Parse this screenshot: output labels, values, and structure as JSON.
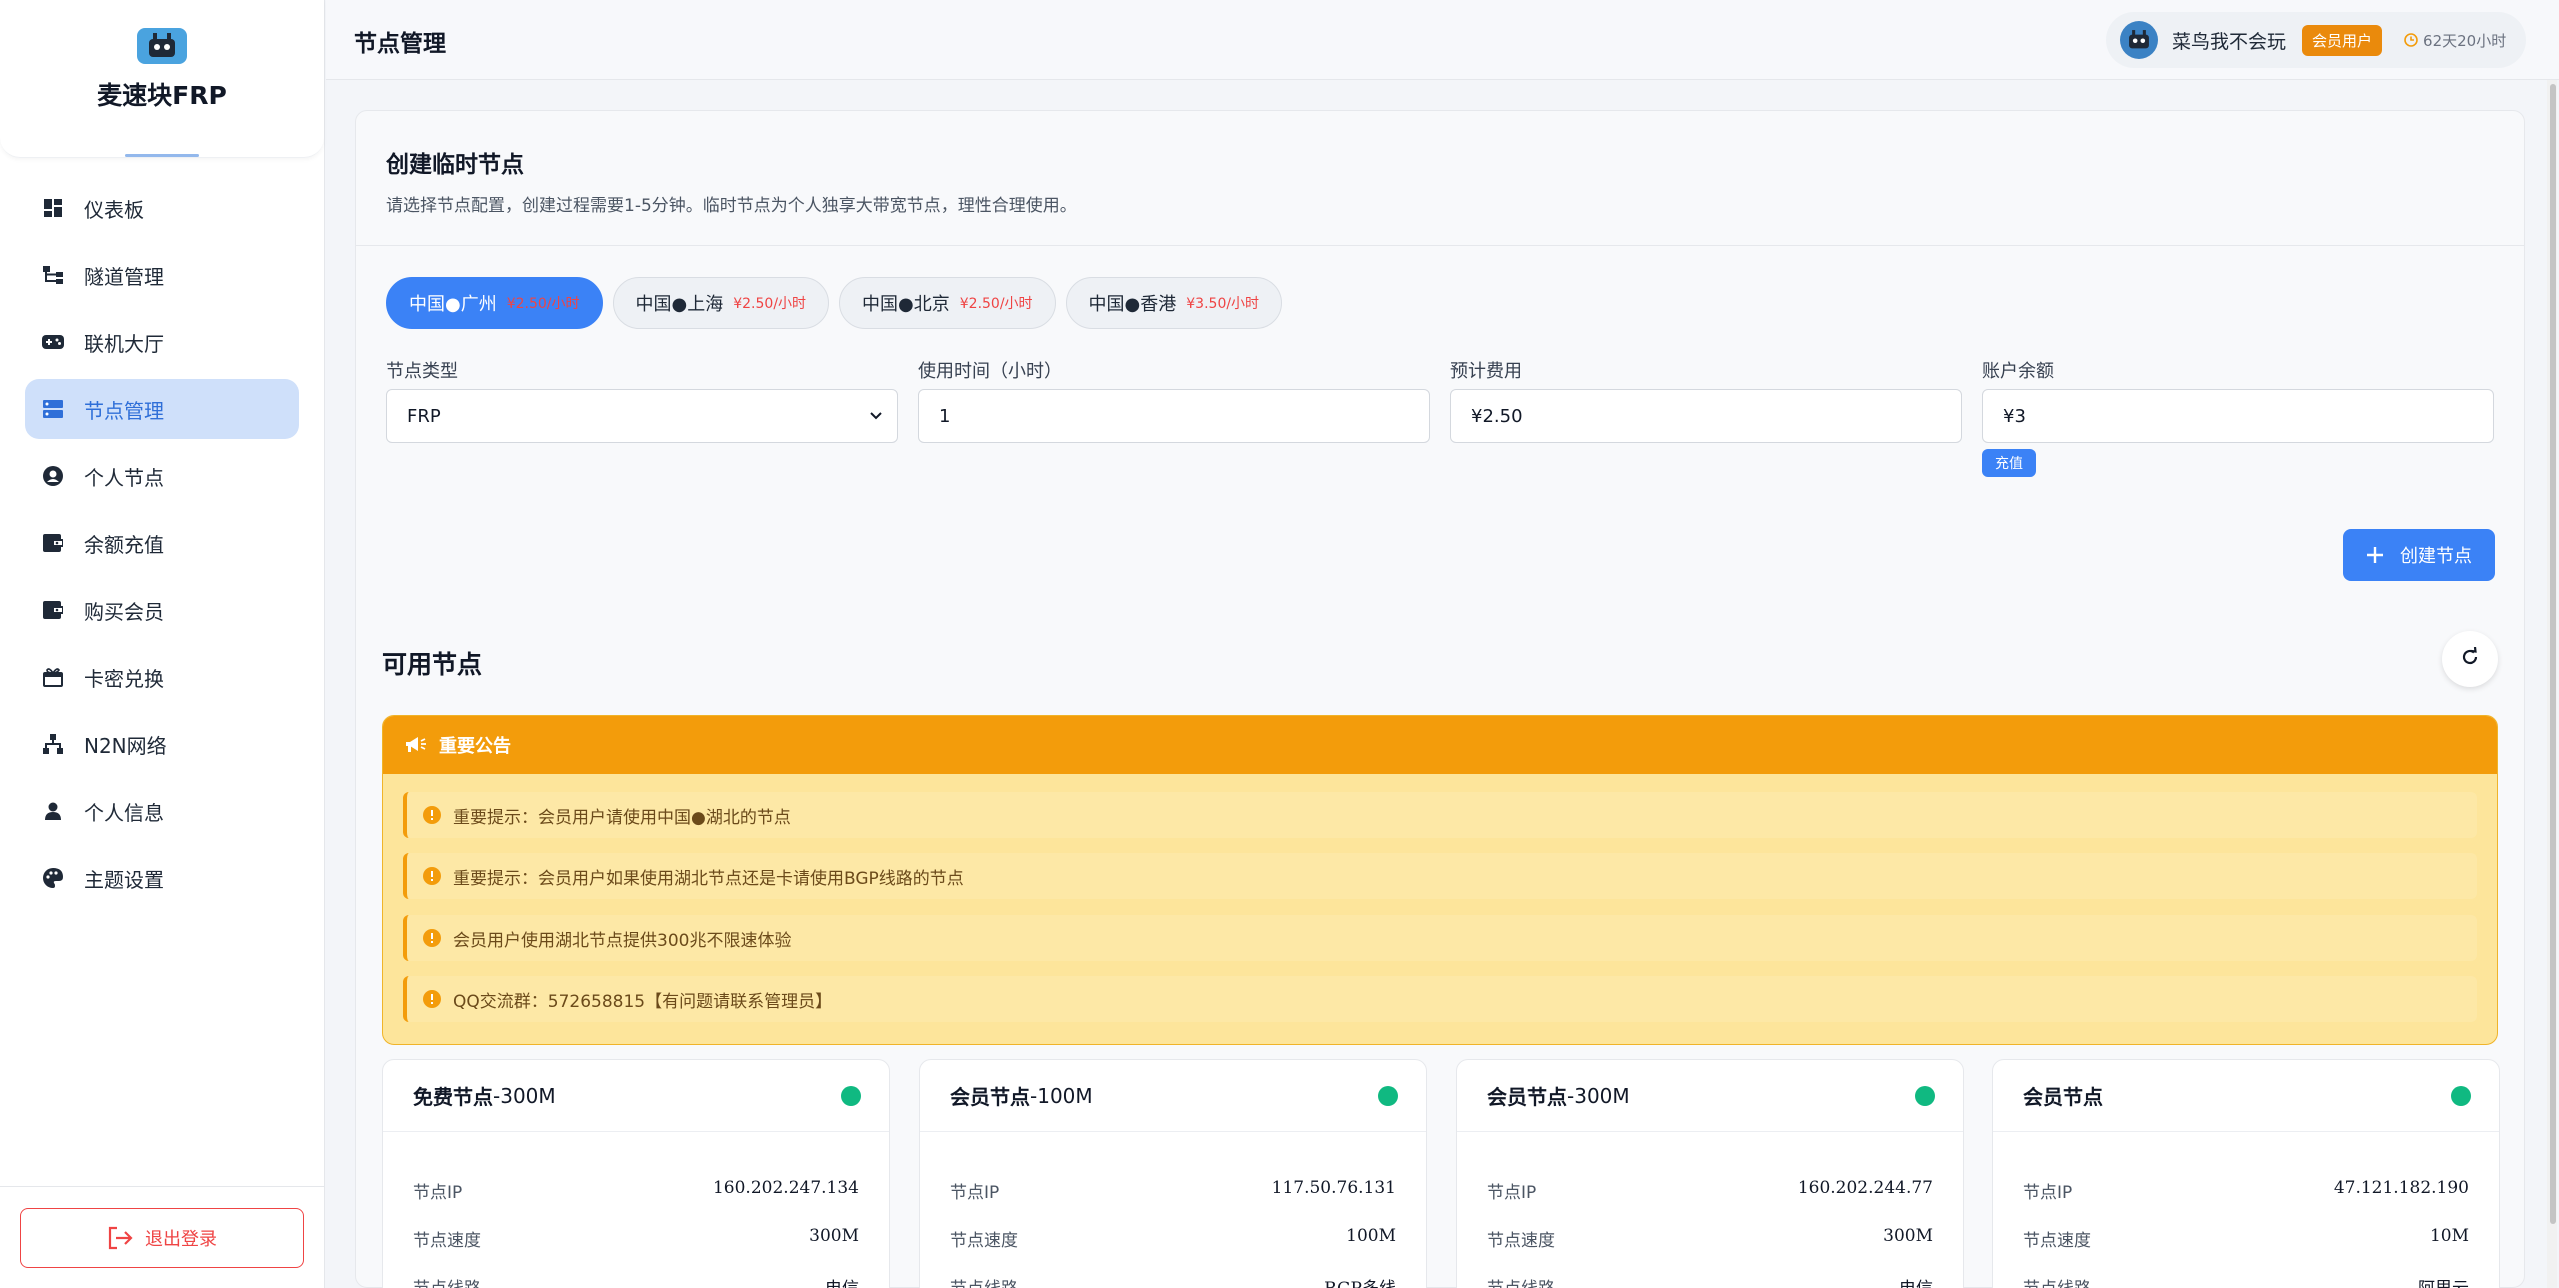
{
  "brand": {
    "title": "麦速块FRP"
  },
  "sidebar": {
    "items": [
      {
        "label": "仪表板",
        "icon": "dashboard-icon"
      },
      {
        "label": "隧道管理",
        "icon": "tunnel-icon"
      },
      {
        "label": "联机大厅",
        "icon": "gamepad-icon"
      },
      {
        "label": "节点管理",
        "icon": "server-icon",
        "active": true
      },
      {
        "label": "个人节点",
        "icon": "user-circle-icon"
      },
      {
        "label": "余额充值",
        "icon": "wallet-icon"
      },
      {
        "label": "购买会员",
        "icon": "wallet-icon"
      },
      {
        "label": "卡密兑换",
        "icon": "gift-icon"
      },
      {
        "label": "N2N网络",
        "icon": "network-icon"
      },
      {
        "label": "个人信息",
        "icon": "user-icon"
      },
      {
        "label": "主题设置",
        "icon": "palette-icon"
      }
    ],
    "logout_label": "退出登录"
  },
  "header": {
    "title": "节点管理",
    "user_name": "菜鸟我不会玩",
    "badge": "会员用户",
    "time_left": "62天20小时"
  },
  "create": {
    "title": "创建临时节点",
    "desc": "请选择节点配置，创建过程需要1-5分钟。临时节点为个人独享大带宽节点，理性合理使用。",
    "regions": [
      {
        "name": "中国●广州",
        "price": "¥2.50/小时",
        "active": true
      },
      {
        "name": "中国●上海",
        "price": "¥2.50/小时"
      },
      {
        "name": "中国●北京",
        "price": "¥2.50/小时"
      },
      {
        "name": "中国●香港",
        "price": "¥3.50/小时"
      }
    ],
    "type_label": "节点类型",
    "type_value": "FRP",
    "hours_label": "使用时间（小时）",
    "hours_value": "1",
    "cost_label": "预计费用",
    "cost_value": "¥2.50",
    "balance_label": "账户余额",
    "balance_value": "¥3",
    "recharge_label": "充值",
    "create_label": "创建节点"
  },
  "available": {
    "title": "可用节点",
    "notice_title": "重要公告",
    "notices": [
      "重要提示：会员用户请使用中国●湖北的节点",
      "重要提示：会员用户如果使用湖北节点还是卡请使用BGP线路的节点",
      "会员用户使用湖北节点提供300兆不限速体验",
      "QQ交流群：572658815【有问题请联系管理员】"
    ],
    "nodes": [
      {
        "name_bold": "免费节点",
        "name_rest": "-300M",
        "ip_label": "节点IP",
        "ip": "160.202.247.134",
        "speed_label": "节点速度",
        "speed": "300M",
        "line_label": "节点线路",
        "line": "电信",
        "status_color": "#10b981"
      },
      {
        "name_bold": "会员节点",
        "name_rest": "-100M",
        "ip_label": "节点IP",
        "ip": "117.50.76.131",
        "speed_label": "节点速度",
        "speed": "100M",
        "line_label": "节点线路",
        "line": "BGP多线",
        "status_color": "#10b981"
      },
      {
        "name_bold": "会员节点",
        "name_rest": "-300M",
        "ip_label": "节点IP",
        "ip": "160.202.244.77",
        "speed_label": "节点速度",
        "speed": "300M",
        "line_label": "节点线路",
        "line": "电信",
        "status_color": "#10b981"
      },
      {
        "name_bold": "会员节点",
        "name_rest": "",
        "ip_label": "节点IP",
        "ip": "47.121.182.190",
        "speed_label": "节点速度",
        "speed": "10M",
        "line_label": "节点线路",
        "line": "阿里云",
        "status_color": "#10b981"
      }
    ]
  },
  "colors": {
    "accent": "#3b82f6",
    "warning": "#f39c0b",
    "danger": "#ef4444",
    "online": "#10b981"
  }
}
